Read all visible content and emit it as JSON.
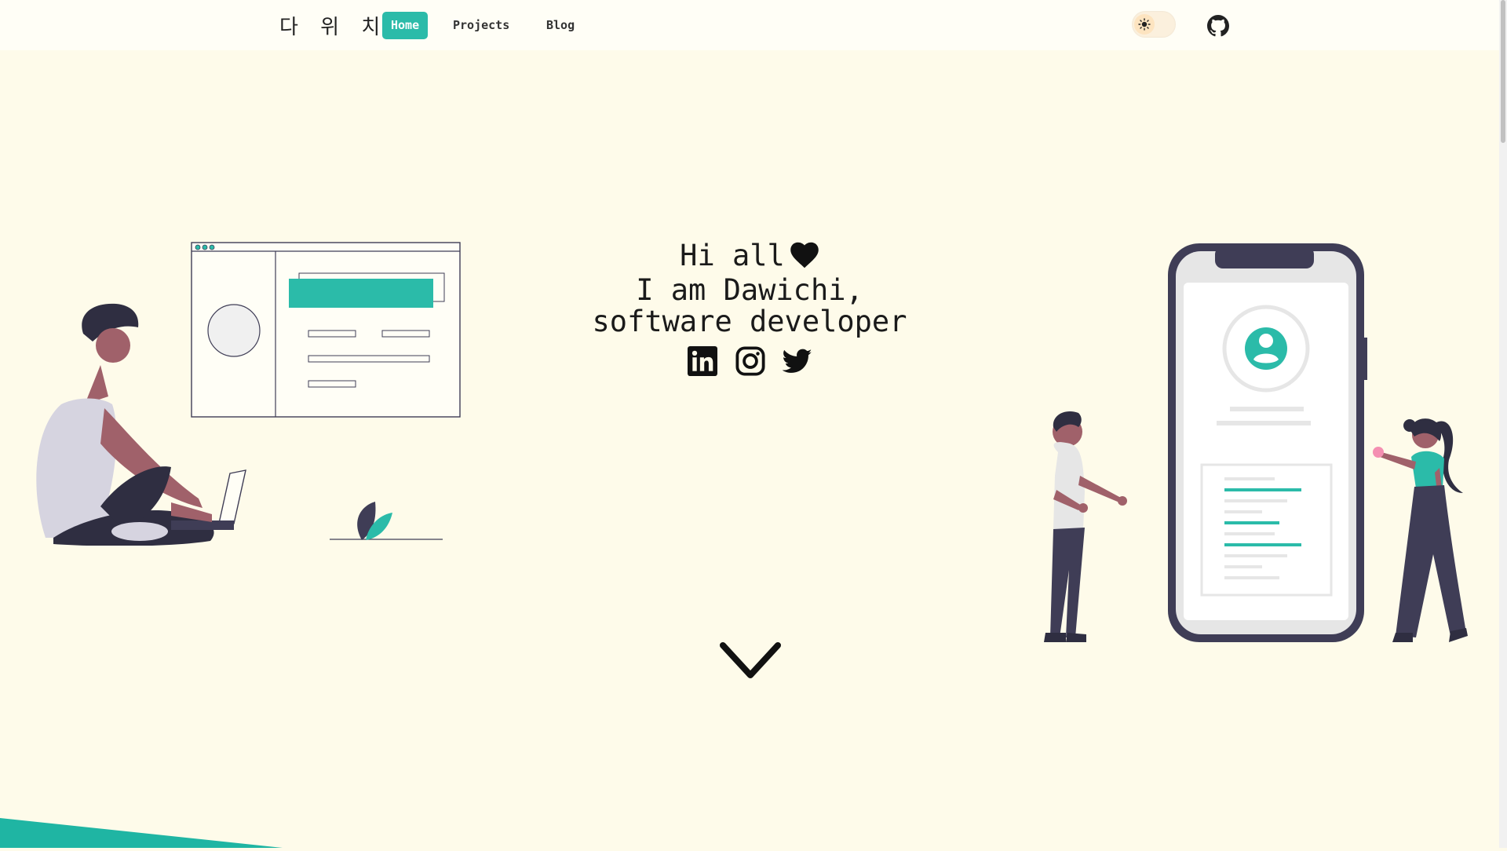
{
  "nav": {
    "logo": "다 위 치",
    "links": [
      {
        "label": "Home",
        "active": true
      },
      {
        "label": "Projects",
        "active": false
      },
      {
        "label": "Blog",
        "active": false
      }
    ],
    "theme_icon": "sun-icon",
    "github_icon": "github-icon"
  },
  "hero": {
    "line1": "Hi all",
    "line2": "I am Dawichi,",
    "line3": "software developer",
    "heart_icon": "heart-icon",
    "socials": [
      {
        "name": "linkedin-icon"
      },
      {
        "name": "instagram-icon"
      },
      {
        "name": "twitter-icon"
      }
    ],
    "scroll_icon": "chevron-down-icon"
  },
  "colors": {
    "background": "#fefbea",
    "accent": "#2bbba9",
    "dark": "#3f3d56",
    "skin": "#a0616a"
  }
}
